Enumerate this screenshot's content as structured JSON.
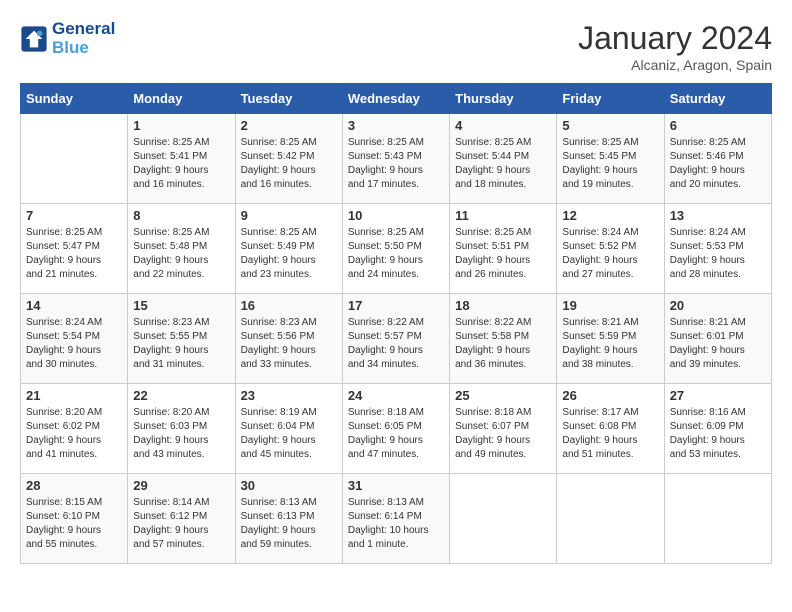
{
  "header": {
    "logo_line1": "General",
    "logo_line2": "Blue",
    "month": "January 2024",
    "location": "Alcaniz, Aragon, Spain"
  },
  "days_of_week": [
    "Sunday",
    "Monday",
    "Tuesday",
    "Wednesday",
    "Thursday",
    "Friday",
    "Saturday"
  ],
  "weeks": [
    [
      {
        "day": "",
        "info": ""
      },
      {
        "day": "1",
        "info": "Sunrise: 8:25 AM\nSunset: 5:41 PM\nDaylight: 9 hours\nand 16 minutes."
      },
      {
        "day": "2",
        "info": "Sunrise: 8:25 AM\nSunset: 5:42 PM\nDaylight: 9 hours\nand 16 minutes."
      },
      {
        "day": "3",
        "info": "Sunrise: 8:25 AM\nSunset: 5:43 PM\nDaylight: 9 hours\nand 17 minutes."
      },
      {
        "day": "4",
        "info": "Sunrise: 8:25 AM\nSunset: 5:44 PM\nDaylight: 9 hours\nand 18 minutes."
      },
      {
        "day": "5",
        "info": "Sunrise: 8:25 AM\nSunset: 5:45 PM\nDaylight: 9 hours\nand 19 minutes."
      },
      {
        "day": "6",
        "info": "Sunrise: 8:25 AM\nSunset: 5:46 PM\nDaylight: 9 hours\nand 20 minutes."
      }
    ],
    [
      {
        "day": "7",
        "info": "Sunrise: 8:25 AM\nSunset: 5:47 PM\nDaylight: 9 hours\nand 21 minutes."
      },
      {
        "day": "8",
        "info": "Sunrise: 8:25 AM\nSunset: 5:48 PM\nDaylight: 9 hours\nand 22 minutes."
      },
      {
        "day": "9",
        "info": "Sunrise: 8:25 AM\nSunset: 5:49 PM\nDaylight: 9 hours\nand 23 minutes."
      },
      {
        "day": "10",
        "info": "Sunrise: 8:25 AM\nSunset: 5:50 PM\nDaylight: 9 hours\nand 24 minutes."
      },
      {
        "day": "11",
        "info": "Sunrise: 8:25 AM\nSunset: 5:51 PM\nDaylight: 9 hours\nand 26 minutes."
      },
      {
        "day": "12",
        "info": "Sunrise: 8:24 AM\nSunset: 5:52 PM\nDaylight: 9 hours\nand 27 minutes."
      },
      {
        "day": "13",
        "info": "Sunrise: 8:24 AM\nSunset: 5:53 PM\nDaylight: 9 hours\nand 28 minutes."
      }
    ],
    [
      {
        "day": "14",
        "info": "Sunrise: 8:24 AM\nSunset: 5:54 PM\nDaylight: 9 hours\nand 30 minutes."
      },
      {
        "day": "15",
        "info": "Sunrise: 8:23 AM\nSunset: 5:55 PM\nDaylight: 9 hours\nand 31 minutes."
      },
      {
        "day": "16",
        "info": "Sunrise: 8:23 AM\nSunset: 5:56 PM\nDaylight: 9 hours\nand 33 minutes."
      },
      {
        "day": "17",
        "info": "Sunrise: 8:22 AM\nSunset: 5:57 PM\nDaylight: 9 hours\nand 34 minutes."
      },
      {
        "day": "18",
        "info": "Sunrise: 8:22 AM\nSunset: 5:58 PM\nDaylight: 9 hours\nand 36 minutes."
      },
      {
        "day": "19",
        "info": "Sunrise: 8:21 AM\nSunset: 5:59 PM\nDaylight: 9 hours\nand 38 minutes."
      },
      {
        "day": "20",
        "info": "Sunrise: 8:21 AM\nSunset: 6:01 PM\nDaylight: 9 hours\nand 39 minutes."
      }
    ],
    [
      {
        "day": "21",
        "info": "Sunrise: 8:20 AM\nSunset: 6:02 PM\nDaylight: 9 hours\nand 41 minutes."
      },
      {
        "day": "22",
        "info": "Sunrise: 8:20 AM\nSunset: 6:03 PM\nDaylight: 9 hours\nand 43 minutes."
      },
      {
        "day": "23",
        "info": "Sunrise: 8:19 AM\nSunset: 6:04 PM\nDaylight: 9 hours\nand 45 minutes."
      },
      {
        "day": "24",
        "info": "Sunrise: 8:18 AM\nSunset: 6:05 PM\nDaylight: 9 hours\nand 47 minutes."
      },
      {
        "day": "25",
        "info": "Sunrise: 8:18 AM\nSunset: 6:07 PM\nDaylight: 9 hours\nand 49 minutes."
      },
      {
        "day": "26",
        "info": "Sunrise: 8:17 AM\nSunset: 6:08 PM\nDaylight: 9 hours\nand 51 minutes."
      },
      {
        "day": "27",
        "info": "Sunrise: 8:16 AM\nSunset: 6:09 PM\nDaylight: 9 hours\nand 53 minutes."
      }
    ],
    [
      {
        "day": "28",
        "info": "Sunrise: 8:15 AM\nSunset: 6:10 PM\nDaylight: 9 hours\nand 55 minutes."
      },
      {
        "day": "29",
        "info": "Sunrise: 8:14 AM\nSunset: 6:12 PM\nDaylight: 9 hours\nand 57 minutes."
      },
      {
        "day": "30",
        "info": "Sunrise: 8:13 AM\nSunset: 6:13 PM\nDaylight: 9 hours\nand 59 minutes."
      },
      {
        "day": "31",
        "info": "Sunrise: 8:13 AM\nSunset: 6:14 PM\nDaylight: 10 hours\nand 1 minute."
      },
      {
        "day": "",
        "info": ""
      },
      {
        "day": "",
        "info": ""
      },
      {
        "day": "",
        "info": ""
      }
    ]
  ]
}
